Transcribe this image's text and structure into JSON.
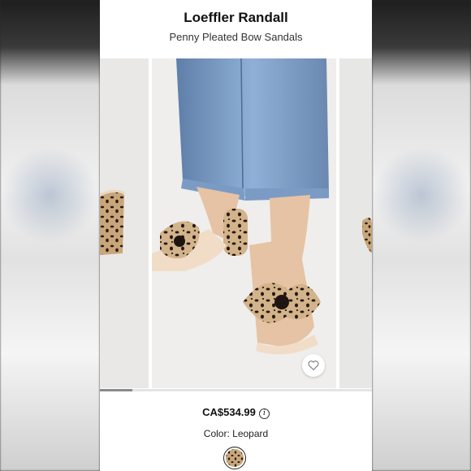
{
  "product": {
    "brand": "Loeffler Randall",
    "name": "Penny Pleated Bow Sandals",
    "price": "CA$534.99",
    "color_label": "Color: Leopard"
  },
  "gallery": {
    "image_count_visible": 3,
    "current_index": 1
  },
  "icons": {
    "favorite": "heart-icon",
    "price_info": "info-icon",
    "swatch": "leopard-swatch"
  },
  "colors": {
    "denim": "#7b9bc4",
    "leopard_base": "#c9a67a",
    "leopard_spot": "#2a1d14"
  }
}
